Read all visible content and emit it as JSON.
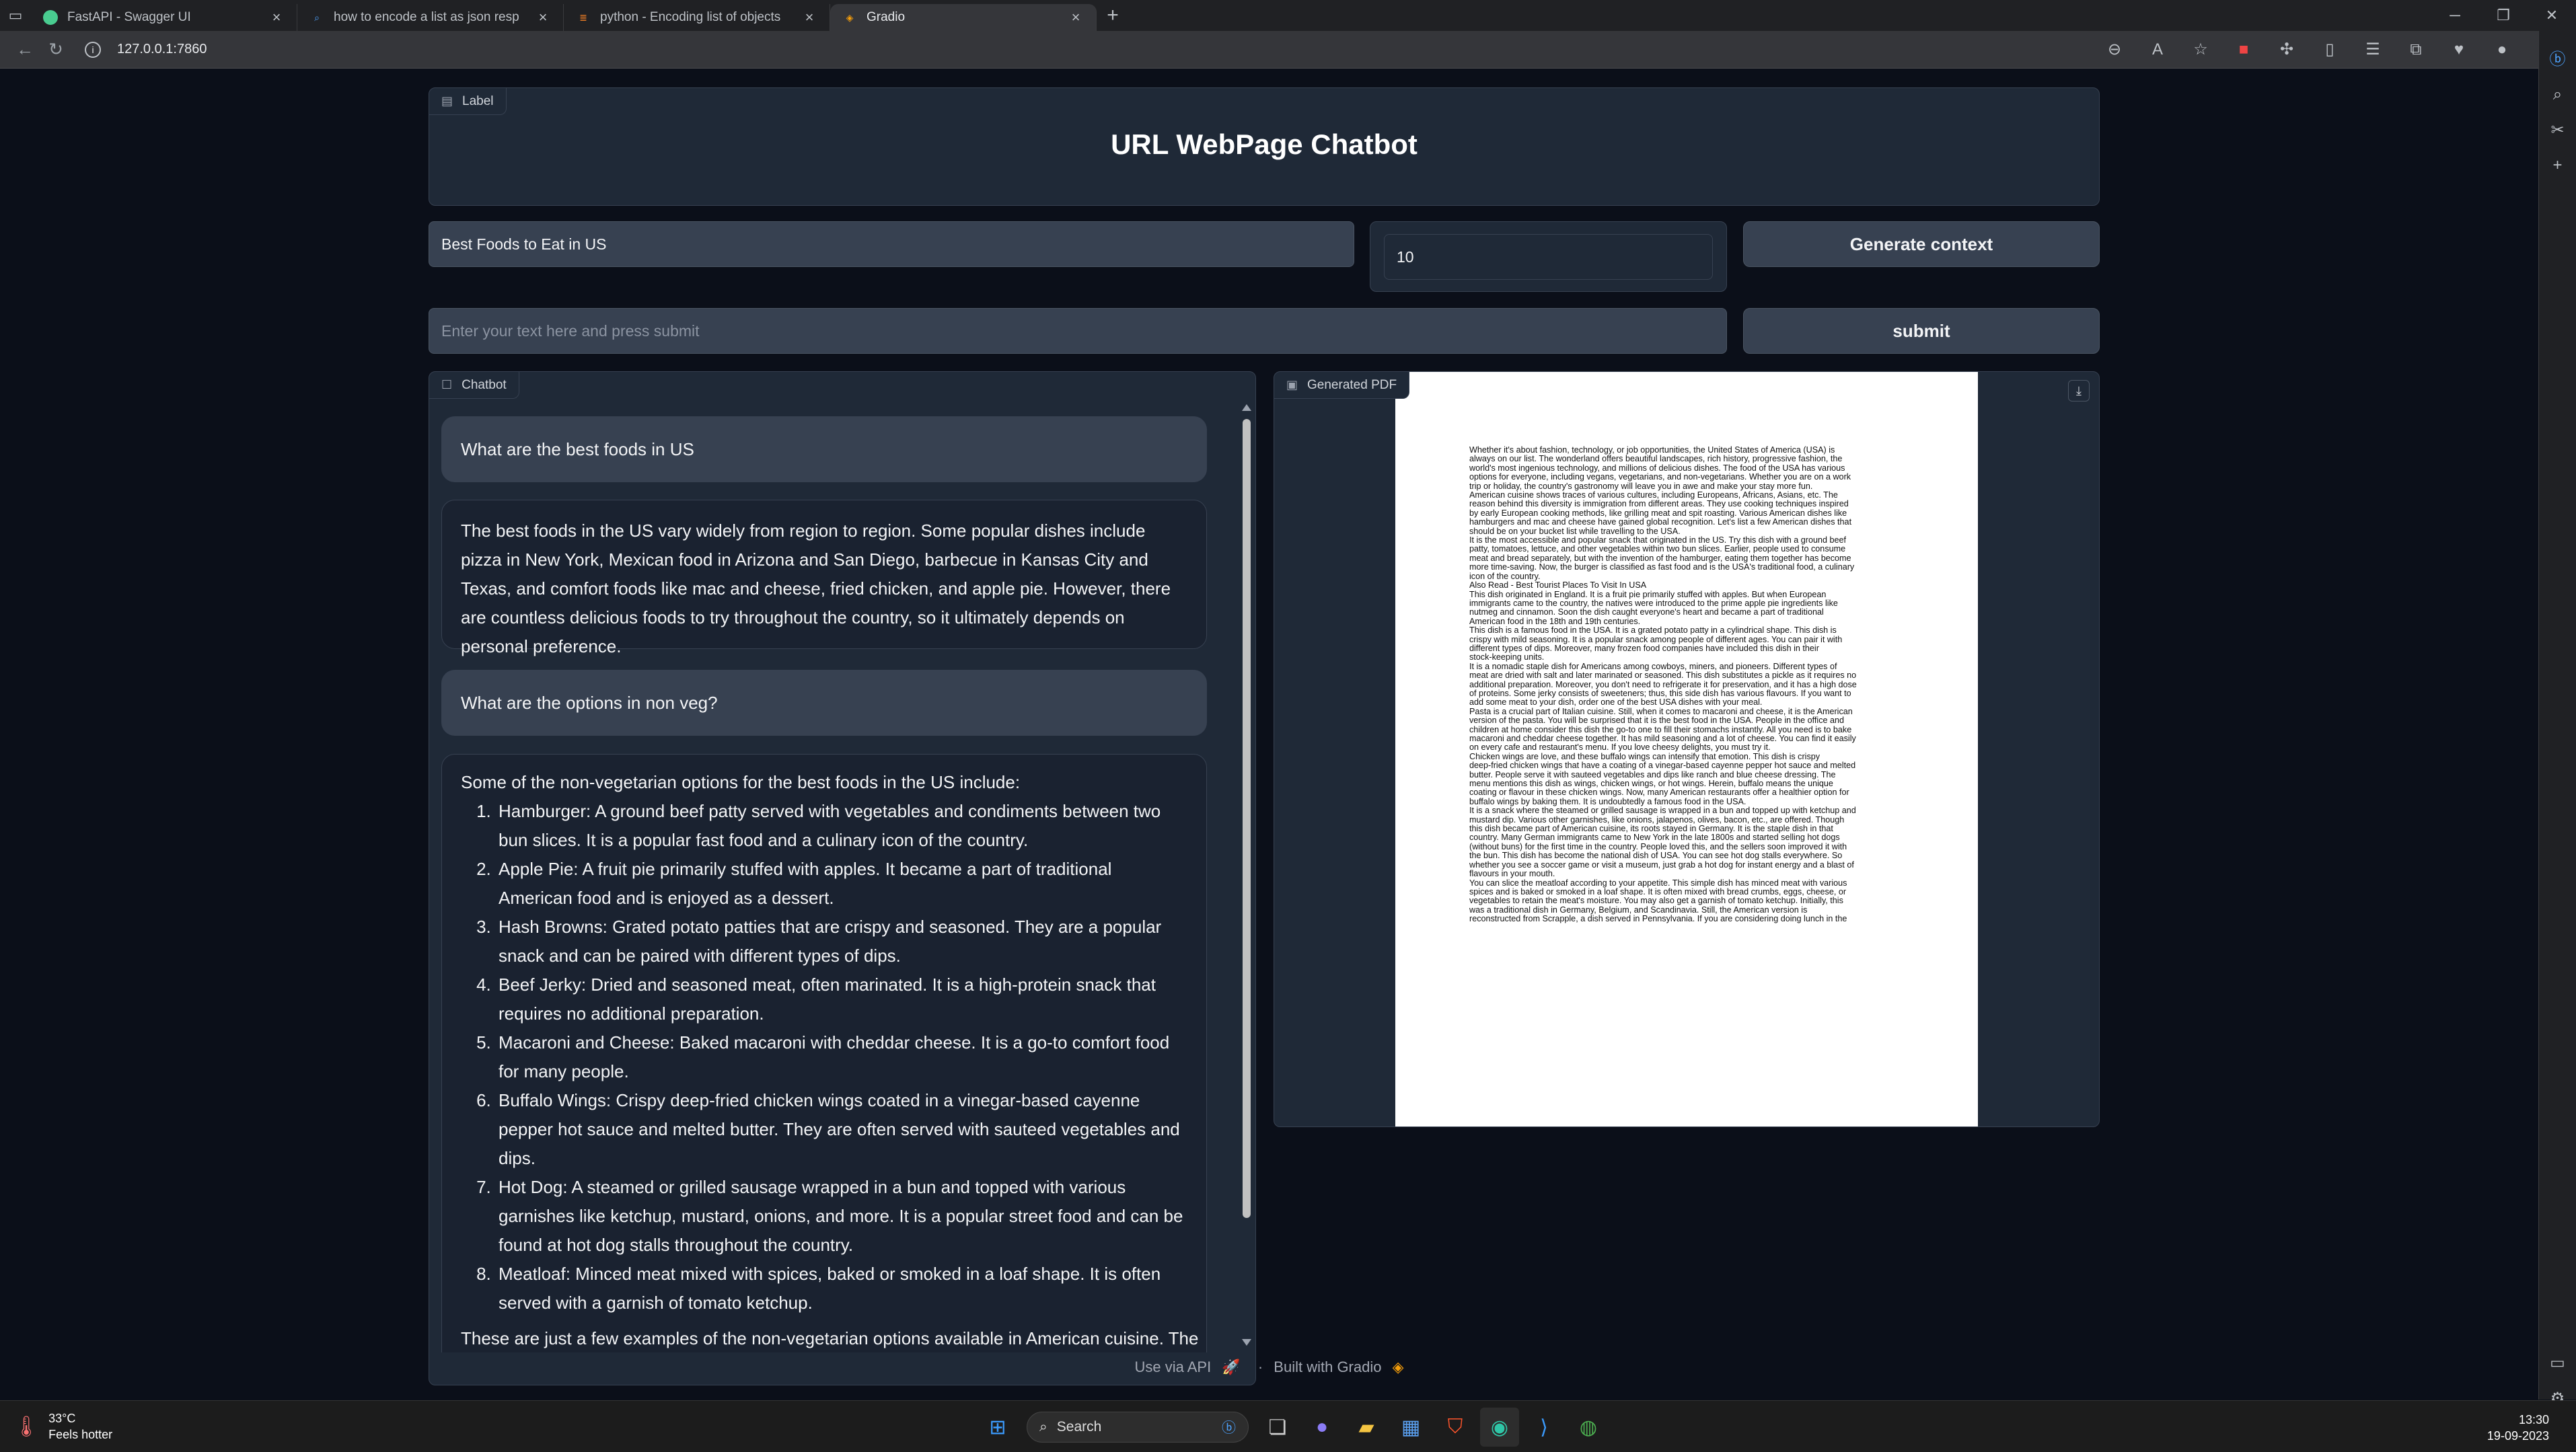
{
  "browser": {
    "tabs": [
      {
        "title": "FastAPI - Swagger UI",
        "color": "#49cc90",
        "icon": "fastapi-icon"
      },
      {
        "title": "how to encode a list as json resp",
        "color": "#4da3ff",
        "icon": "search-icon"
      },
      {
        "title": "python - Encoding list of objects",
        "color": "#f48024",
        "icon": "stackoverflow-icon"
      },
      {
        "title": "Gradio",
        "color": "#f59e0b",
        "icon": "gradio-icon"
      }
    ],
    "url": "127.0.0.1:7860"
  },
  "app": {
    "header": {
      "label": "Label",
      "title": "URL WebPage Chatbot"
    },
    "query_input": {
      "value": "Best Foods to Eat in US"
    },
    "count_input": {
      "value": "10"
    },
    "generate_button": "Generate context",
    "text_input": {
      "placeholder": "Enter your text here and press submit"
    },
    "submit_button": "submit",
    "chatbot": {
      "label": "Chatbot",
      "messages": [
        {
          "role": "user",
          "text": "What are the best foods in US"
        },
        {
          "role": "bot",
          "text": "The best foods in the US vary widely from region to region. Some popular dishes include pizza in New York, Mexican food in Arizona and San Diego, barbecue in Kansas City and Texas, and comfort foods like mac and cheese, fried chicken, and apple pie. However, there are countless delicious foods to try throughout the country, so it ultimately depends on personal preference."
        },
        {
          "role": "user",
          "text": "What are the options in non veg?"
        },
        {
          "role": "bot",
          "intro": "Some of the non-vegetarian options for the best foods in the US include:",
          "items": [
            "Hamburger: A ground beef patty served with vegetables and condiments between two bun slices. It is a popular fast food and a culinary icon of the country.",
            "Apple Pie: A fruit pie primarily stuffed with apples. It became a part of traditional American food and is enjoyed as a dessert.",
            "Hash Browns: Grated potato patties that are crispy and seasoned. They are a popular snack and can be paired with different types of dips.",
            "Beef Jerky: Dried and seasoned meat, often marinated. It is a high-protein snack that requires no additional preparation.",
            "Macaroni and Cheese: Baked macaroni with cheddar cheese. It is a go-to comfort food for many people.",
            "Buffalo Wings: Crispy deep-fried chicken wings coated in a vinegar-based cayenne pepper hot sauce and melted butter. They are often served with sauteed vegetables and dips.",
            "Hot Dog: A steamed or grilled sausage wrapped in a bun and topped with various garnishes like ketchup, mustard, onions, and more. It is a popular street food and can be found at hot dog stalls throughout the country.",
            "Meatloaf: Minced meat mixed with spices, baked or smoked in a loaf shape. It is often served with a garnish of tomato ketchup."
          ],
          "trailing": "These are just a few examples of the non-vegetarian options available in American cuisine. The"
        }
      ]
    },
    "pdf": {
      "label": "Generated PDF",
      "lines": [
        "Whether it's about fashion, technology, or job opportunities, the United States of America (USA) is",
        "always on our list. The wonderland offers beautiful landscapes, rich history, progressive fashion, the",
        "world's most ingenious technology, and millions of delicious dishes. The food of the USA has various",
        "options for everyone, including vegans, vegetarians, and non-vegetarians. Whether you are on a work",
        "trip or holiday, the country's gastronomy will leave you in awe and make your stay more fun.",
        "American cuisine shows traces of various cultures, including Europeans, Africans, Asians, etc. The",
        "reason behind this diversity is immigration from different areas. They use cooking techniques inspired",
        "by early European cooking methods, like grilling meat and spit roasting. Various American dishes like",
        "hamburgers and mac and cheese have gained global recognition. Let's list a few American dishes that",
        "should be on your bucket list while travelling to the USA.",
        "It is the most accessible and popular snack that originated in the US. Try this dish with a ground beef",
        "patty, tomatoes, lettuce, and other vegetables within two bun slices. Earlier, people used to consume",
        "meat and bread separately, but with the invention of the hamburger, eating them together has become",
        "more time-saving. Now, the burger is classified as fast food and is the USA's traditional food, a culinary",
        "icon of the country.",
        "Also Read - Best Tourist Places To Visit In USA",
        "This dish originated in England. It is a fruit pie primarily stuffed with apples. But when European",
        "immigrants came to the country, the natives were introduced to the prime apple pie ingredients like",
        "nutmeg and cinnamon. Soon the dish caught everyone's heart and became a part of traditional",
        "American food in the 18th and 19th centuries.",
        "This dish is a famous food in the USA. It is a grated potato patty in a cylindrical shape. This dish is",
        "crispy with mild seasoning. It is a popular snack among people of different ages. You can pair it with",
        "different types of dips. Moreover, many frozen food companies have included this dish in their",
        "stock-keeping units.",
        "It is a nomadic staple dish for Americans among cowboys, miners, and pioneers. Different types of",
        "meat are dried with salt and later marinated or seasoned. This dish substitutes a pickle as it requires no",
        "additional preparation. Moreover, you don't need to refrigerate it for preservation, and it has a high dose",
        "of proteins. Some jerky consists of sweeteners; thus, this side dish has various flavours. If you want to",
        "add some meat to your dish, order one of the best USA dishes with your meal.",
        "Pasta is a crucial part of Italian cuisine. Still, when it comes to macaroni and cheese, it is the American",
        "version of the pasta. You will be surprised that it is the best food in the USA. People in the office and",
        "children at home consider this dish the go-to one to fill their stomachs instantly. All you need is to bake",
        "macaroni and cheddar cheese together. It has mild seasoning and a lot of cheese. You can find it easily",
        "on every cafe and restaurant's menu. If you love cheesy delights, you must try it.",
        "Chicken wings are love, and these buffalo wings can intensify that emotion. This dish is crispy",
        "deep-fried chicken wings that have a coating of a vinegar-based cayenne pepper hot sauce and melted",
        "butter. People serve it with sauteed vegetables and dips like ranch and blue cheese dressing. The",
        "menu mentions this dish as wings, chicken wings, or hot wings. Herein, buffalo means the unique",
        "coating or flavour in these chicken wings. Now, many American restaurants offer a healthier option for",
        "buffalo wings by baking them. It is undoubtedly a famous food in the USA.",
        "It is a snack where the steamed or grilled sausage is wrapped in a bun and topped up with ketchup and",
        "mustard dip. Various other garnishes, like onions, jalapenos, olives, bacon, etc., are offered. Though",
        "this dish became part of American cuisine, its roots stayed in Germany. It is the staple dish in that",
        "country. Many German immigrants came to New York in the late 1800s and started selling hot dogs",
        "(without buns) for the first time in the country. People loved this, and the sellers soon improved it with",
        "the bun. This dish has become the national dish of USA. You can see hot dog stalls everywhere. So",
        "whether you see a soccer game or visit a museum, just grab a hot dog for instant energy and a blast of",
        "flavours in your mouth.",
        "You can slice the meatloaf according to your appetite. This simple dish has minced meat with various",
        "spices and is baked or smoked in a loaf shape. It is often mixed with bread crumbs, eggs, cheese, or",
        "vegetables to retain the meat's moisture. You may also get a garnish of tomato ketchup. Initially, this",
        "was a traditional dish in Germany, Belgium, and Scandinavia. Still, the American version is",
        "reconstructed from Scrapple, a dish served in Pennsylvania. If you are considering doing lunch in the"
      ]
    },
    "footer": {
      "api": "Use via API",
      "sep": "·",
      "built": "Built with Gradio"
    }
  },
  "taskbar": {
    "weather": {
      "temp": "33°C",
      "desc": "Feels hotter"
    },
    "search": "Search",
    "time": "13:30",
    "date": "19-09-2023"
  },
  "colors": {
    "accent": "#f59e0b",
    "panel": "#1f2937",
    "background": "#0b0f19"
  }
}
